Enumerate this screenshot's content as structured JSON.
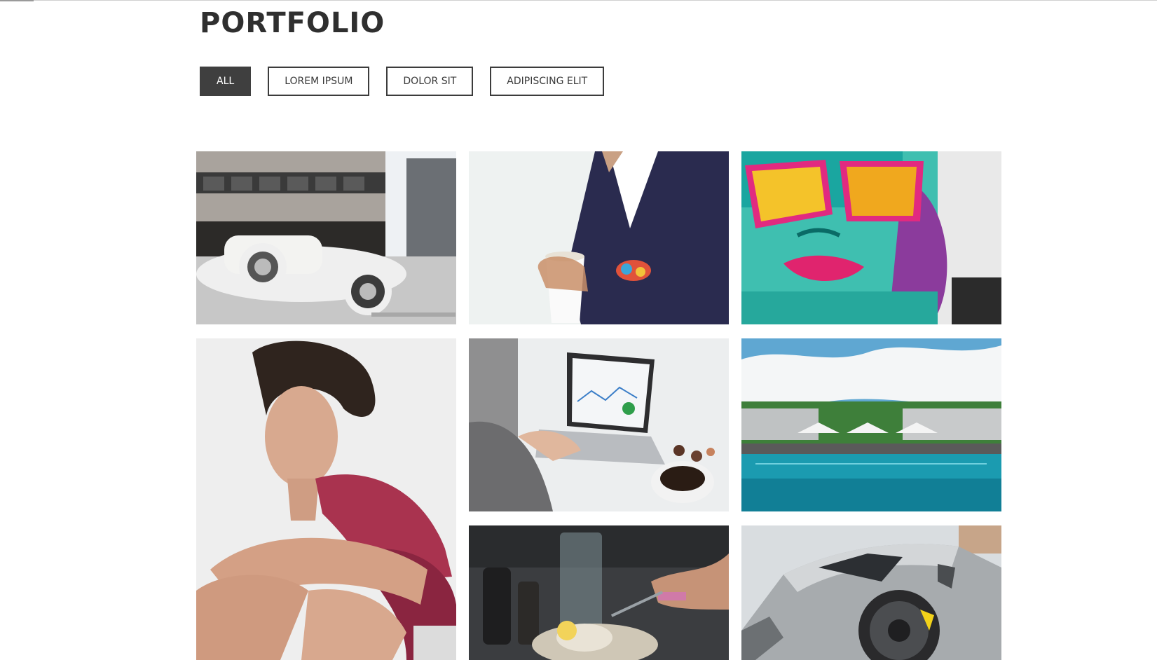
{
  "page": {
    "title": "PORTFOLIO"
  },
  "filters": [
    {
      "label": "ALL",
      "active": true
    },
    {
      "label": "LOREM IPSUM",
      "active": false
    },
    {
      "label": "DOLOR SIT",
      "active": false
    },
    {
      "label": "ADIPISCING ELIT",
      "active": false
    }
  ],
  "colors": {
    "active_filter_bg": "#3f3f3f",
    "border": "#3c3c3c",
    "title": "#2f2f2f"
  },
  "gallery": {
    "items": [
      {
        "subject": "vintage-car-street-photo"
      },
      {
        "subject": "man-suit-coffee-photo"
      },
      {
        "subject": "graffiti-woman-sunglasses-photo"
      },
      {
        "subject": "fashion-model-red-dress-photo"
      },
      {
        "subject": "laptop-analytics-coffee-photo"
      },
      {
        "subject": "resort-pool-photo"
      },
      {
        "subject": "restaurant-table-photo"
      },
      {
        "subject": "silver-sports-car-photo"
      }
    ]
  }
}
